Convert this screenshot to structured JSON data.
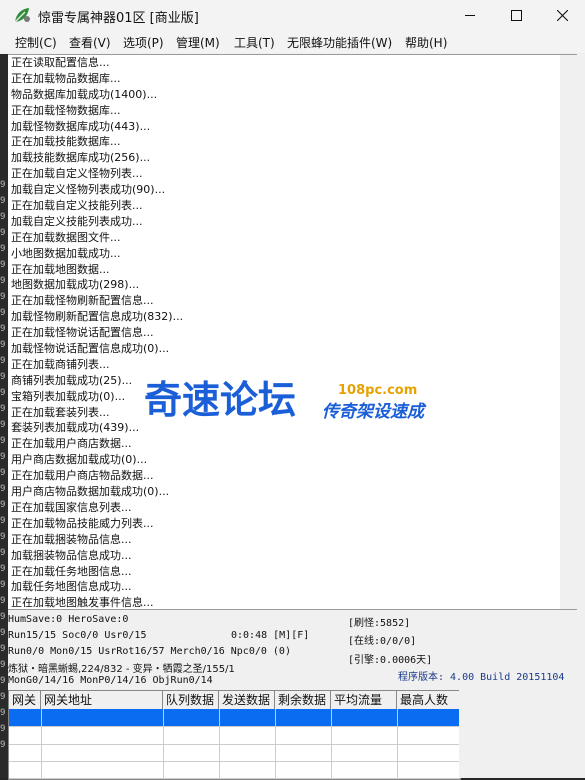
{
  "window": {
    "title": "惊雷专属神器01区 [商业版]",
    "accent": "#0a6cf0"
  },
  "menu": [
    "控制(C)",
    "查看(V)",
    "选项(P)",
    "管理(M)",
    "工具(T)",
    "无限蜂功能插件(W)",
    "帮助(H)"
  ],
  "log": [
    "正在读取配置信息...",
    "正在加载物品数据库...",
    "物品数据库加载成功(1400)...",
    "正在加载怪物数据库...",
    "加载怪物数据库成功(443)...",
    "正在加载技能数据库...",
    "加载技能数据库成功(256)...",
    "正在加载自定义怪物列表...",
    "加载自定义怪物列表成功(90)...",
    "正在加载自定义技能列表...",
    "加载自定义技能列表成功...",
    "正在加载数据图文件...",
    "小地图数据加载成功...",
    "正在加载地图数据...",
    "地图数据加载成功(298)...",
    "正在加载怪物刷新配置信息...",
    "加载怪物刷新配置信息成功(832)...",
    "正在加载怪物说话配置信息...",
    "加载怪物说话配置信息成功(0)...",
    "正在加载商铺列表...",
    "商铺列表加载成功(25)...",
    "宝箱列表加载成功(0)...",
    "正在加载套装列表...",
    "套装列表加载成功(439)...",
    "正在加载用户商店数据...",
    "用户商店数据加载成功(0)...",
    "正在加载用户商店物品数据...",
    "用户商店物品数据加载成功(0)...",
    "正在加载国家信息列表...",
    "正在加载物品技能威力列表...",
    "正在加载捆装物品信息...",
    "加载捆装物品信息成功...",
    "正在加载任务地图信息...",
    "加载任务地图信息成功...",
    "正在加载地图触发事件信息..."
  ],
  "left_digits": [
    "9",
    "9",
    "9",
    "9",
    "9",
    "9",
    "9",
    "9",
    "9",
    "9",
    "9",
    "9",
    "9",
    "9",
    "9",
    "9",
    "9",
    "9",
    "9",
    "9",
    "9",
    "9",
    "9",
    "9",
    "9",
    "9",
    "9",
    "9",
    "9",
    "9",
    "9",
    "9",
    "9",
    "9",
    "9",
    "9"
  ],
  "status": {
    "line1": "HumSave:0 HeroSave:0",
    "line2": "Run15/15 Soc0/0 Usr0/15",
    "time": "0:0:48 [M][F]",
    "line3": "Run0/0 Mon0/15 UsrRot16/57 Merch0/16 Npc0/0 (0)",
    "line4": "炼狱・暗黑蜥蜴,224/832 - 变异・牺霞之圣/155/1",
    "line5": "MonG0/14/16 MonP0/14/16 ObjRun0/14",
    "refresh": "[刷怪:5852]",
    "online": "[在线:0/0/0]",
    "engine": "[引擎:0.0006天]",
    "version": "程序版本: 4.00 Build 20151104"
  },
  "table": {
    "columns": [
      "网关",
      "网关地址",
      "队列数据",
      "发送数据",
      "剩余数据",
      "平均流量",
      "最高人数"
    ]
  },
  "watermark": {
    "main": "奇速论坛",
    "site": "108pc.com",
    "slogan": "传奇架设速成"
  }
}
